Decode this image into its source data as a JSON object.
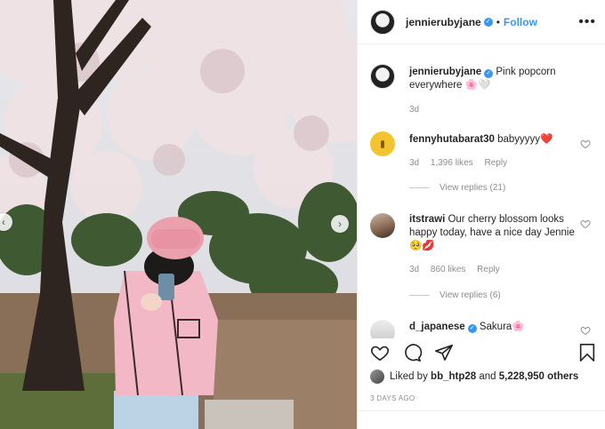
{
  "post": {
    "username": "jennierubyjane",
    "follow_label": "Follow",
    "dot": "•",
    "more": "•••",
    "caption": "Pink popcorn everywhere",
    "caption_emoji": "🌸🤍",
    "caption_age": "3d",
    "liked_by_prefix": "Liked by",
    "liked_by_user": "bb_htp28",
    "liked_by_and": "and",
    "liked_count": "5,228,950 others",
    "timestamp": "3 DAYS AGO"
  },
  "comments": [
    {
      "username": "fennyhutabarat30",
      "text": "babyyyyy",
      "emoji": "❤️",
      "age": "3d",
      "likes": "1,396 likes",
      "reply": "Reply",
      "view_replies": "View replies (21)"
    },
    {
      "username": "itstrawi",
      "text": "Our cherry blossom looks happy today, have a nice day Jennie",
      "emoji": "🥺💋",
      "age": "3d",
      "likes": "860 likes",
      "reply": "Reply",
      "view_replies": "View replies (6)"
    },
    {
      "username": "d_japanese",
      "text": "Sakura",
      "emoji": "🌸"
    }
  ],
  "icons": [
    "more-icon",
    "verified-icon",
    "heart-icon",
    "comment-icon",
    "share-icon",
    "bookmark-icon",
    "arrow-left-icon",
    "arrow-right-icon"
  ],
  "colors": {
    "link": "#3897f0",
    "muted": "#8e8e8e",
    "text": "#262626"
  }
}
